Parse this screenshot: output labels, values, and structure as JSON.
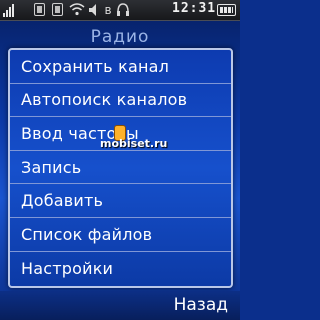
{
  "status_bar": {
    "time": "12:31",
    "bluetooth_symbol": "ʙ",
    "icons": [
      "signal-icon",
      "sim-icon",
      "card-icon",
      "wifi-icon",
      "speaker-icon",
      "bluetooth-icon",
      "headset-icon",
      "battery-icon"
    ]
  },
  "screen": {
    "title": "Радио"
  },
  "menu": {
    "items": [
      {
        "label": "Сохранить канал"
      },
      {
        "label": "Автопоиск каналов"
      },
      {
        "label": "Ввод частоты"
      },
      {
        "label": "Запись"
      },
      {
        "label": "Добавить"
      },
      {
        "label": "Список файлов"
      },
      {
        "label": "Настройки"
      }
    ]
  },
  "watermark": {
    "text": "mobiset.ru"
  },
  "softkeys": {
    "right": "Назад"
  },
  "colors": {
    "background": "#0c3aa8",
    "menu_border": "#b9c7e8",
    "text": "#ffffff",
    "title": "#9bb4e6"
  }
}
